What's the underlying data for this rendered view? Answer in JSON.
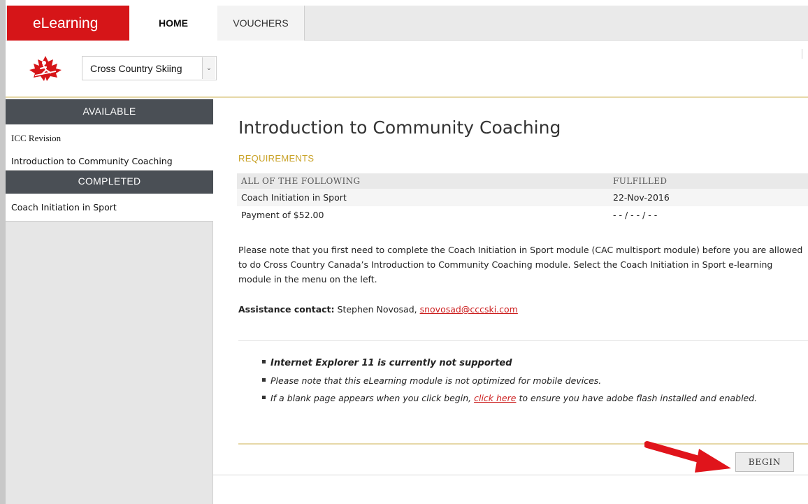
{
  "nav": {
    "brand": "eLearning",
    "tabs": [
      {
        "label": "HOME"
      },
      {
        "label": "VOUCHERS"
      }
    ]
  },
  "sport_selector": {
    "selected": "Cross Country Skiing"
  },
  "sidebar": {
    "available_heading": "AVAILABLE",
    "available_items": [
      {
        "label": "ICC Revision"
      },
      {
        "label": "Introduction to Community Coaching"
      }
    ],
    "completed_heading": "COMPLETED",
    "completed_items": [
      {
        "label": "Coach Initiation in Sport"
      }
    ]
  },
  "main": {
    "title": "Introduction to Community Coaching",
    "requirements_label": "REQUIREMENTS",
    "table": {
      "headers": [
        "ALL OF THE FOLLOWING",
        "FULFILLED"
      ],
      "rows": [
        {
          "item": "Coach Initiation in Sport",
          "fulfilled": "22-Nov-2016"
        },
        {
          "item": "Payment of $52.00",
          "fulfilled": "- - / - - / - -"
        }
      ]
    },
    "paragraph": "Please note that you first need to complete the Coach Initiation in Sport module (CAC multisport module) before you are allowed to do Cross Country Canada’s Introduction to Community Coaching module. Select the Coach Initiation in Sport e-learning module in the menu on the left.",
    "contact": {
      "label": "Assistance contact:",
      "name": "Stephen Novosad,",
      "email": "snovosad@cccski.com"
    },
    "notes": {
      "n1": "Internet Explorer 11 is currently not supported",
      "n2": "Please note that this eLearning module is not optimized for mobile devices.",
      "n3_before": "If a blank page appears when you click begin,",
      "n3_link": "click here",
      "n3_after": "to ensure you have adobe flash installed and enabled."
    },
    "begin_label": "BEGIN"
  },
  "colors": {
    "brand_red": "#d61518",
    "sidebar_head": "#4a4f55",
    "gold": "#c9a227",
    "link_red": "#cc1f1f",
    "arrow_red": "#e0141b"
  }
}
